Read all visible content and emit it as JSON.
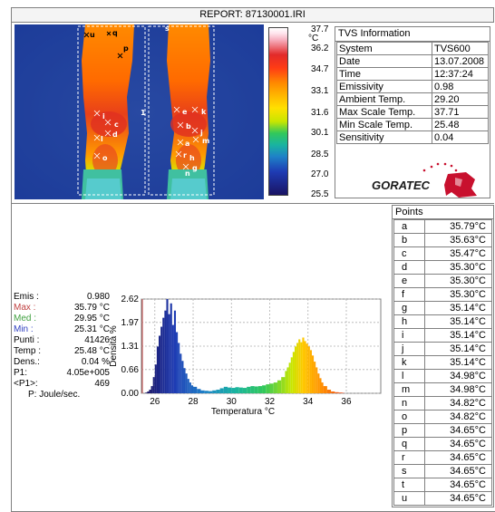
{
  "report_title": "REPORT: 87130001.IRI",
  "thermo_markers": [
    "u",
    "q",
    "p",
    "s",
    "1",
    "e",
    "k",
    "i",
    "c",
    "b",
    "j",
    "d",
    "l",
    "a",
    "m",
    "r",
    "o",
    "h",
    "g",
    "n"
  ],
  "scale": {
    "unit": "°C",
    "labels": [
      "37.7",
      "36.2",
      "34.7",
      "33.1",
      "31.6",
      "30.1",
      "28.5",
      "27.0",
      "25.5"
    ]
  },
  "tvs_info": {
    "header": "TVS Information",
    "rows": [
      {
        "key": "System",
        "value": "TVS600"
      },
      {
        "key": "Date",
        "value": "13.07.2008"
      },
      {
        "key": "Time",
        "value": "12:37:24"
      },
      {
        "key": "Emissivity",
        "value": "0.98"
      },
      {
        "key": "Ambient Temp.",
        "value": "29.20"
      },
      {
        "key": "Max Scale Temp.",
        "value": "37.71"
      },
      {
        "key": "Min Scale Temp.",
        "value": "25.48"
      },
      {
        "key": "Sensitivity",
        "value": "0.04"
      }
    ],
    "logo_text": "GORATEC",
    "colors": {
      "logo_red": "#c8102e"
    }
  },
  "points": {
    "header": "Points",
    "rows": [
      {
        "name": "a",
        "value": "35.79°C"
      },
      {
        "name": "b",
        "value": "35.63°C"
      },
      {
        "name": "c",
        "value": "35.47°C"
      },
      {
        "name": "d",
        "value": "35.30°C"
      },
      {
        "name": "e",
        "value": "35.30°C"
      },
      {
        "name": "f",
        "value": "35.30°C"
      },
      {
        "name": "g",
        "value": "35.14°C"
      },
      {
        "name": "h",
        "value": "35.14°C"
      },
      {
        "name": "i",
        "value": "35.14°C"
      },
      {
        "name": "j",
        "value": "35.14°C"
      },
      {
        "name": "k",
        "value": "35.14°C"
      },
      {
        "name": "l",
        "value": "34.98°C"
      },
      {
        "name": "m",
        "value": "34.98°C"
      },
      {
        "name": "n",
        "value": "34.82°C"
      },
      {
        "name": "o",
        "value": "34.82°C"
      },
      {
        "name": "p",
        "value": "34.65°C"
      },
      {
        "name": "q",
        "value": "34.65°C"
      },
      {
        "name": "r",
        "value": "34.65°C"
      },
      {
        "name": "s",
        "value": "34.65°C"
      },
      {
        "name": "t",
        "value": "34.65°C"
      },
      {
        "name": "u",
        "value": "34.65°C"
      }
    ]
  },
  "stats": {
    "rows": [
      {
        "label": "Emis :",
        "value": "0.980",
        "color": "#000000"
      },
      {
        "label": "Max :",
        "value": "35.79 °C",
        "color": "#c04040"
      },
      {
        "label": "Med :",
        "value": "29.95 °C",
        "color": "#40a040"
      },
      {
        "label": "Min :",
        "value": "25.31 °C",
        "color": "#3040c0"
      },
      {
        "label": "Punti :",
        "value": "41426",
        "color": "#000000"
      },
      {
        "label": "Temp :",
        "value": "25.48 °C",
        "color": "#000000"
      },
      {
        "label": "Dens.:",
        "value": "0.04 %",
        "color": "#000000"
      },
      {
        "label": "P1:",
        "value": "4.05e+005",
        "color": "#000000"
      },
      {
        "label": "<P1>:",
        "value": "469",
        "color": "#000000"
      }
    ],
    "footer": "P: Joule/sec."
  },
  "chart_data": {
    "type": "bar",
    "xlabel": "Temperatura °C",
    "ylabel": "Densità %",
    "xlim": [
      25.3,
      37.8
    ],
    "ylim": [
      0,
      2.62
    ],
    "xticks": [
      26,
      28,
      30,
      32,
      34,
      36
    ],
    "xtick_labels": [
      "26",
      "28",
      "30",
      "32",
      "34",
      "36"
    ],
    "yticks": [
      0,
      0.66,
      1.31,
      1.97,
      2.62
    ],
    "ytick_labels": [
      "0.00",
      "0.66",
      "1.31",
      "1.97",
      "2.62"
    ],
    "grid": true,
    "x": [
      25.5,
      25.6,
      25.7,
      25.8,
      25.9,
      26.0,
      26.1,
      26.2,
      26.3,
      26.4,
      26.5,
      26.6,
      26.7,
      26.8,
      26.9,
      27.0,
      27.1,
      27.2,
      27.3,
      27.4,
      27.5,
      27.6,
      27.7,
      27.8,
      27.9,
      28.0,
      28.2,
      28.4,
      28.6,
      28.8,
      29.0,
      29.2,
      29.4,
      29.6,
      29.8,
      30.0,
      30.2,
      30.4,
      30.6,
      30.8,
      31.0,
      31.2,
      31.4,
      31.6,
      31.8,
      32.0,
      32.2,
      32.4,
      32.6,
      32.8,
      32.9,
      33.0,
      33.1,
      33.2,
      33.3,
      33.4,
      33.5,
      33.6,
      33.7,
      33.8,
      33.9,
      34.0,
      34.1,
      34.2,
      34.3,
      34.4,
      34.5,
      34.6,
      34.7,
      34.8,
      35.0,
      35.2,
      35.4,
      35.6,
      35.8
    ],
    "values": [
      0.02,
      0.05,
      0.1,
      0.2,
      0.45,
      0.8,
      1.3,
      1.6,
      1.85,
      2.1,
      2.3,
      2.62,
      2.2,
      2.5,
      1.9,
      2.3,
      1.7,
      1.4,
      1.1,
      0.9,
      0.7,
      0.55,
      0.4,
      0.3,
      0.22,
      0.18,
      0.12,
      0.08,
      0.07,
      0.06,
      0.08,
      0.1,
      0.14,
      0.18,
      0.16,
      0.15,
      0.17,
      0.16,
      0.15,
      0.18,
      0.2,
      0.19,
      0.2,
      0.22,
      0.25,
      0.27,
      0.3,
      0.36,
      0.45,
      0.62,
      0.72,
      0.85,
      1.0,
      1.15,
      1.3,
      1.4,
      1.5,
      1.42,
      1.55,
      1.45,
      1.38,
      1.3,
      1.2,
      1.05,
      0.88,
      0.72,
      0.55,
      0.42,
      0.3,
      0.2,
      0.1,
      0.05,
      0.03,
      0.02,
      0.01
    ]
  }
}
